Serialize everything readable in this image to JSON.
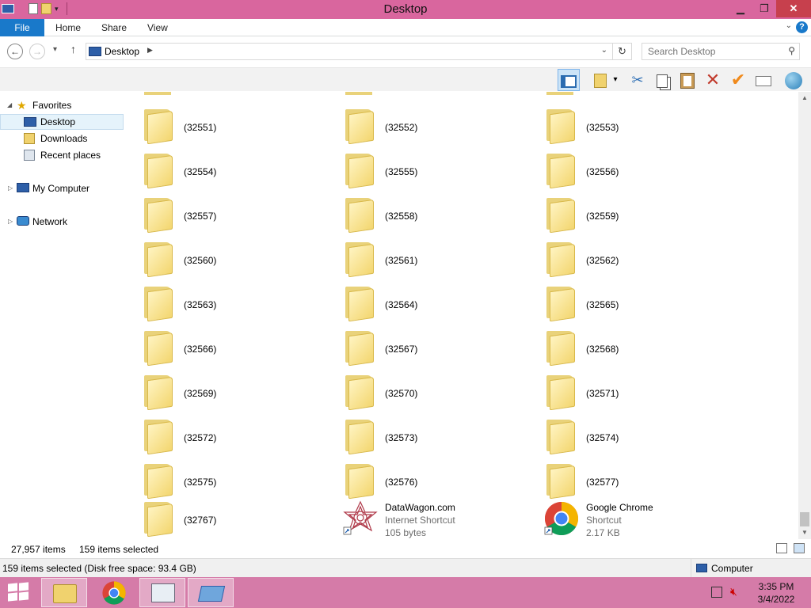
{
  "window": {
    "title": "Desktop"
  },
  "ribbon": {
    "tabs": [
      "File",
      "Home",
      "Share",
      "View"
    ]
  },
  "address": {
    "crumb": "Desktop",
    "search_placeholder": "Search Desktop"
  },
  "nav": {
    "favorites": "Favorites",
    "desktop": "Desktop",
    "downloads": "Downloads",
    "recent": "Recent places",
    "computer": "My Computer",
    "network": "Network"
  },
  "folders": [
    [
      "(32551)",
      "(32552)",
      "(32553)"
    ],
    [
      "(32554)",
      "(32555)",
      "(32556)"
    ],
    [
      "(32557)",
      "(32558)",
      "(32559)"
    ],
    [
      "(32560)",
      "(32561)",
      "(32562)"
    ],
    [
      "(32563)",
      "(32564)",
      "(32565)"
    ],
    [
      "(32566)",
      "(32567)",
      "(32568)"
    ],
    [
      "(32569)",
      "(32570)",
      "(32571)"
    ],
    [
      "(32572)",
      "(32573)",
      "(32574)"
    ],
    [
      "(32575)",
      "(32576)",
      "(32577)"
    ]
  ],
  "last_row": {
    "folder": "(32767)",
    "datawagon": {
      "name": "DataWagon.com",
      "type": "Internet Shortcut",
      "size": "105 bytes"
    },
    "chrome": {
      "name": "Google Chrome",
      "type": "Shortcut",
      "size": "2.17 KB"
    }
  },
  "details": {
    "count": "27,957 items",
    "selected": "159 items selected"
  },
  "status": {
    "message": "159 items selected (Disk free space: 93.4 GB)",
    "zone": "Computer"
  },
  "clock": {
    "time": "3:35 PM",
    "date": "3/4/2022"
  },
  "colors": {
    "titlebar": "#d9669e",
    "taskbar": "#d57ba8",
    "file_tab": "#1979ca",
    "folder": "#f3d66f"
  }
}
